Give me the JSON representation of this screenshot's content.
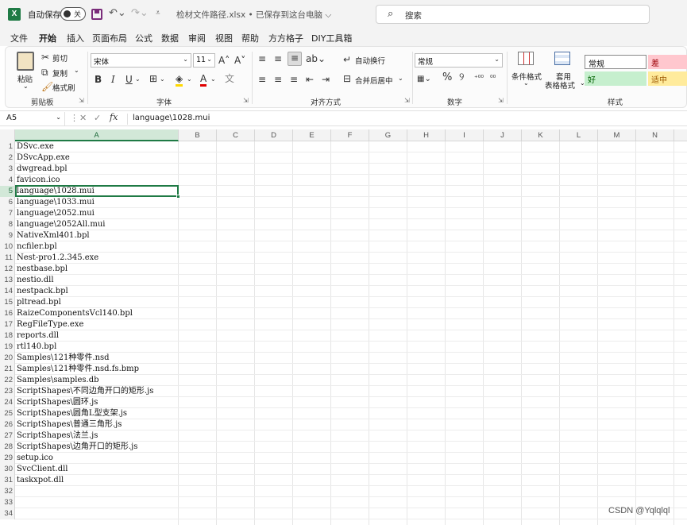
{
  "titlebar": {
    "logo": "X",
    "autosave_label": "自动保存",
    "autosave_state": "关",
    "doc_title": "检材文件路径.xlsx • 已保存到这台电脑 ⌵",
    "search_placeholder": "搜索"
  },
  "menu": {
    "tabs": [
      "文件",
      "开始",
      "插入",
      "页面布局",
      "公式",
      "数据",
      "审阅",
      "视图",
      "帮助",
      "方方格子",
      "DIY工具箱"
    ],
    "active": "开始"
  },
  "ribbon": {
    "clipboard": {
      "paste": "粘贴",
      "cut": "剪切",
      "copy": "复制",
      "format_painter": "格式刷",
      "label": "剪贴板"
    },
    "font": {
      "name": "宋体",
      "size": "11",
      "label": "字体"
    },
    "alignment": {
      "wrap": "自动换行",
      "merge": "合并后居中",
      "label": "对齐方式"
    },
    "number": {
      "format": "常规",
      "label": "数字"
    },
    "styles": {
      "conditional": "条件格式",
      "table_format_1": "套用",
      "table_format_2": "表格格式",
      "normal": "常规",
      "bad": "差",
      "good": "好",
      "neutral": "适中",
      "label": "样式",
      "colors": {
        "bad_bg": "#ffc7ce",
        "bad_fg": "#9c0006",
        "good_bg": "#c6efce",
        "good_fg": "#006100",
        "neutral_bg": "#ffeb9c",
        "neutral_fg": "#9c5700"
      }
    }
  },
  "formula_bar": {
    "name_box": "A5",
    "value": "language\\1028.mui"
  },
  "sheet": {
    "columns": [
      "A",
      "B",
      "C",
      "D",
      "E",
      "F",
      "G",
      "H",
      "I",
      "J",
      "K",
      "L",
      "M",
      "N"
    ],
    "rows": [
      "1",
      "2",
      "3",
      "4",
      "5",
      "6",
      "7",
      "8",
      "9",
      "10",
      "11",
      "12",
      "13",
      "14",
      "15",
      "16",
      "17",
      "18",
      "19",
      "20",
      "21",
      "22",
      "23",
      "24",
      "25",
      "26",
      "27",
      "28",
      "29",
      "30",
      "31",
      "32",
      "33",
      "34"
    ],
    "selected_cell": "A5",
    "a_values": [
      "DSvc.exe",
      "DSvcApp.exe",
      "dwgread.bpl",
      "favicon.ico",
      "language\\1028.mui",
      "language\\1033.mui",
      "language\\2052.mui",
      "language\\2052All.mui",
      "NativeXml401.bpl",
      "ncfiler.bpl",
      "Nest-pro1.2.345.exe",
      "nestbase.bpl",
      "nestio.dll",
      "nestpack.bpl",
      "pltread.bpl",
      "RaizeComponentsVcl140.bpl",
      "RegFileType.exe",
      "reports.dll",
      "rtl140.bpl",
      "Samples\\121种零件.nsd",
      "Samples\\121种零件.nsd.fs.bmp",
      "Samples\\samples.db",
      "ScriptShapes\\不同边角开口的矩形.js",
      "ScriptShapes\\圆环.js",
      "ScriptShapes\\圆角L型支架.js",
      "ScriptShapes\\普通三角形.js",
      "ScriptShapes\\法兰.js",
      "ScriptShapes\\边角开口的矩形.js",
      "setup.ico",
      "SvcClient.dll",
      "taskxpot.dll"
    ]
  },
  "watermark": "CSDN @Yqlqlql"
}
